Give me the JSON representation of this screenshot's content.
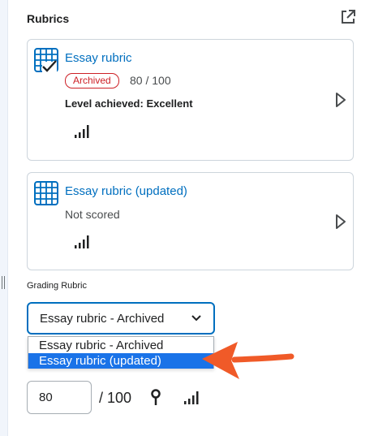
{
  "panel": {
    "title": "Rubrics",
    "popout_icon": "external-link-icon"
  },
  "rubric_cards": [
    {
      "name": "Essay rubric",
      "badge": "Archived",
      "score": "80 / 100",
      "level": "Level achieved: Excellent",
      "icon": "rubric-checked-grid-icon"
    },
    {
      "name": "Essay rubric (updated)",
      "status": "Not scored",
      "icon": "rubric-grid-icon"
    }
  ],
  "grading": {
    "label": "Grading Rubric",
    "selected": "Essay rubric - Archived",
    "options": [
      "Essay rubric - Archived",
      "Essay rubric (updated)"
    ],
    "highlighted_option": 1
  },
  "score": {
    "value": "80",
    "out_of": "/ 100"
  },
  "colors": {
    "link": "#006fbf",
    "archived": "#cd2026",
    "highlight": "#1a73e8",
    "arrow": "#f05a28"
  }
}
